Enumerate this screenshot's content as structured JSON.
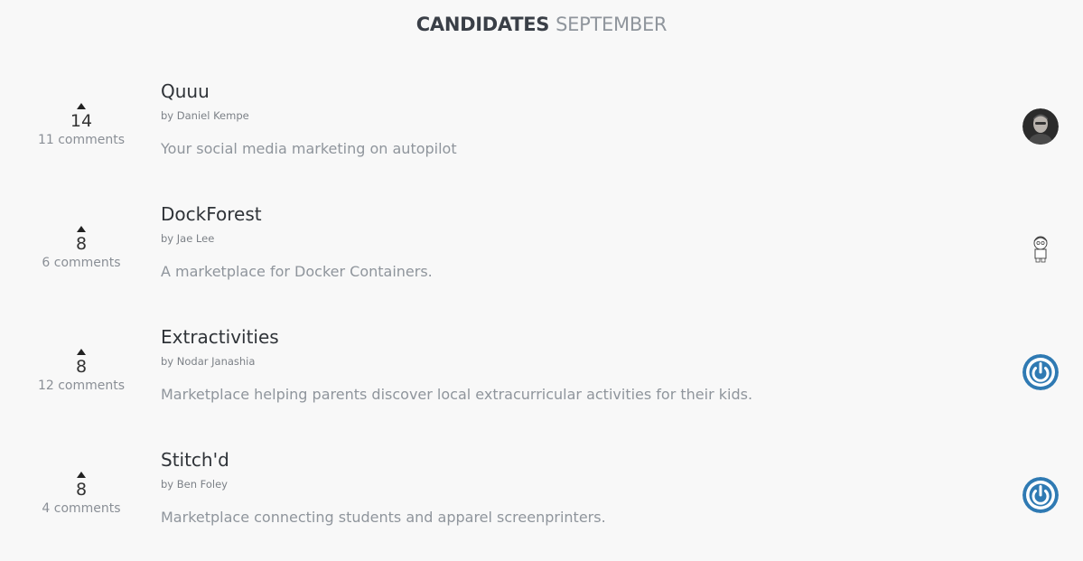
{
  "header": {
    "title_main": "CANDIDATES",
    "title_sub": "SEPTEMBER"
  },
  "candidates": [
    {
      "name": "Quuu",
      "author": "by Daniel Kempe",
      "description": "Your social media marketing on autopilot",
      "votes": "14",
      "comments": "11 comments",
      "avatar_icon": "user-photo-avatar"
    },
    {
      "name": "DockForest",
      "author": "by Jae Lee",
      "description": "A marketplace for Docker Containers.",
      "votes": "8",
      "comments": "6 comments",
      "avatar_icon": "cartoon-character-avatar"
    },
    {
      "name": "Extractivities",
      "author": "by Nodar Janashia",
      "description": "Marketplace helping parents discover local extracurricular activities for their kids.",
      "votes": "8",
      "comments": "12 comments",
      "avatar_icon": "power-symbol-avatar"
    },
    {
      "name": "Stitch'd",
      "author": "by Ben Foley",
      "description": "Marketplace connecting students and apparel screenprinters.",
      "votes": "8",
      "comments": "4 comments",
      "avatar_icon": "power-symbol-avatar"
    }
  ],
  "colors": {
    "background": "#f8f8f8",
    "title_main": "#3a3f47",
    "title_sub": "#8f959c",
    "avatar_blue": "#2f7ab3"
  }
}
